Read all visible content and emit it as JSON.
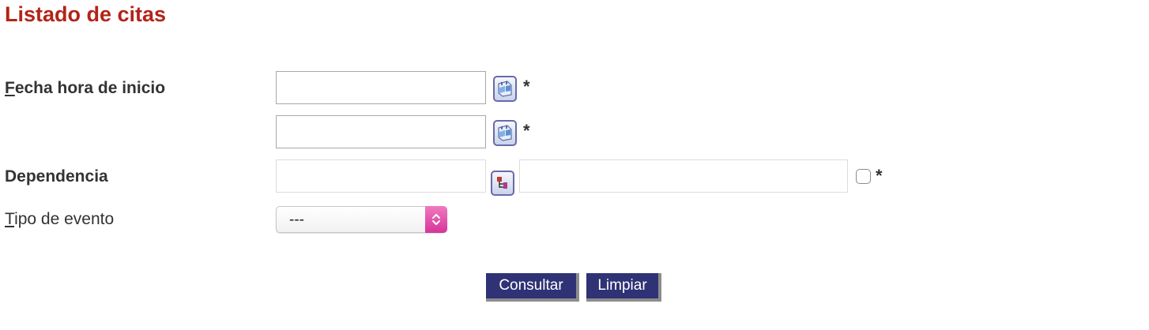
{
  "page": {
    "title": "Listado de citas"
  },
  "form": {
    "fecha": {
      "label_accesskey": "F",
      "label_rest": "echa hora de inicio",
      "start_value": "",
      "end_value": "",
      "required_mark": "*",
      "calendar_icon": "calendar-icon"
    },
    "dependencia": {
      "label": "Dependencia",
      "code_value": "",
      "name_value": "",
      "required_mark": "*",
      "lookup_icon": "tree-lookup-icon",
      "checked": false
    },
    "tipo_evento": {
      "label_accesskey": "T",
      "label_rest": "ipo de evento",
      "selected": "---",
      "accent_color": "#d6359a"
    }
  },
  "buttons": {
    "consultar": "Consultar",
    "limpiar": "Limpiar"
  },
  "colors": {
    "title": "#b22418",
    "button_bg": "#2f3275",
    "button_shadow": "#8c8c8c"
  }
}
